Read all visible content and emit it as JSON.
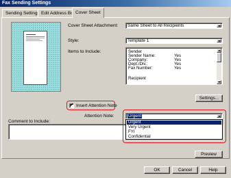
{
  "window": {
    "title": "Fax Sending Settings"
  },
  "tabs": [
    {
      "label": "Sending Settings"
    },
    {
      "label": "Edit Address Book"
    },
    {
      "label": "Cover Sheet"
    }
  ],
  "cover_sheet": {
    "attachment_label": "Cover Sheet Attachment:",
    "attachment_value": "Same Sheet to All Recipients",
    "style_label": "Style:",
    "style_value": "Template 1",
    "items_label": "Items to Include:",
    "items": [
      {
        "label": "Sender",
        "value": ""
      },
      {
        "label": "Sender Name:",
        "value": "Yes"
      },
      {
        "label": "Company:",
        "value": "Yes"
      },
      {
        "label": "Dept./Div.:",
        "value": "Yes"
      },
      {
        "label": "Fax Number:",
        "value": "Yes"
      },
      {
        "label": "",
        "value": ""
      },
      {
        "label": "Recipient",
        "value": ""
      }
    ],
    "settings_button": "Settings...",
    "insert_attention_label": "Insert Attention Note",
    "insert_attention_checked": "✔",
    "attention_note_label": "Attention Note:",
    "attention_note_value": "Urgent",
    "attention_options": [
      "Urgent",
      "Very Urgent",
      "FYI",
      "Confidential"
    ],
    "comment_label": "Comment to Include:",
    "preview_button": "Preview"
  },
  "footer": {
    "ok": "OK",
    "cancel": "Cancel",
    "help": "Help"
  },
  "colors": {
    "highlight": "#0a246a",
    "callout_red": "#e0141e",
    "preview_bg": "#9adcdc"
  }
}
